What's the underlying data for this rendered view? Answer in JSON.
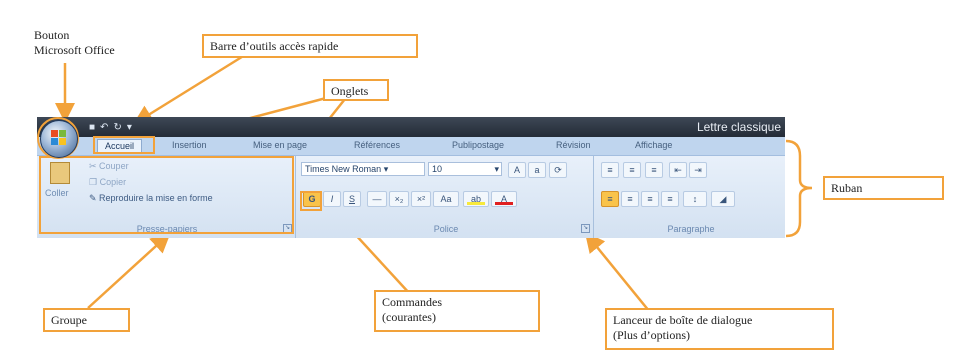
{
  "callouts": {
    "office_button": "Bouton\nMicrosoft Office",
    "quick_access": "Barre d’outils accès rapide",
    "tabs": "Onglets",
    "ribbon": "Ruban",
    "group": "Groupe",
    "commands": "Commandes\n(courantes)",
    "launcher": "Lanceur de boîte de dialogue\n(Plus d’options)"
  },
  "window": {
    "title": "Lettre classique"
  },
  "tabs": [
    "Accueil",
    "Insertion",
    "Mise en page",
    "Références",
    "Publipostage",
    "Révision",
    "Affichage"
  ],
  "clipboard": {
    "paste": "Coller",
    "cut": "Couper",
    "copy": "Copier",
    "format_painter": "Reproduire la mise en forme",
    "title": "Presse-papiers"
  },
  "font": {
    "name": "Times New Roman",
    "size": "10",
    "bold": "G",
    "italic": "I",
    "underline": "S",
    "title": "Police"
  },
  "paragraph": {
    "title": "Paragraphe"
  },
  "colors": {
    "callout_border": "#f2a23a",
    "titlebar": "#2c3440",
    "ribbon": "#dfe9f5",
    "font_color_bar": "#e02020",
    "highlight_bar": "#f7e93b"
  }
}
